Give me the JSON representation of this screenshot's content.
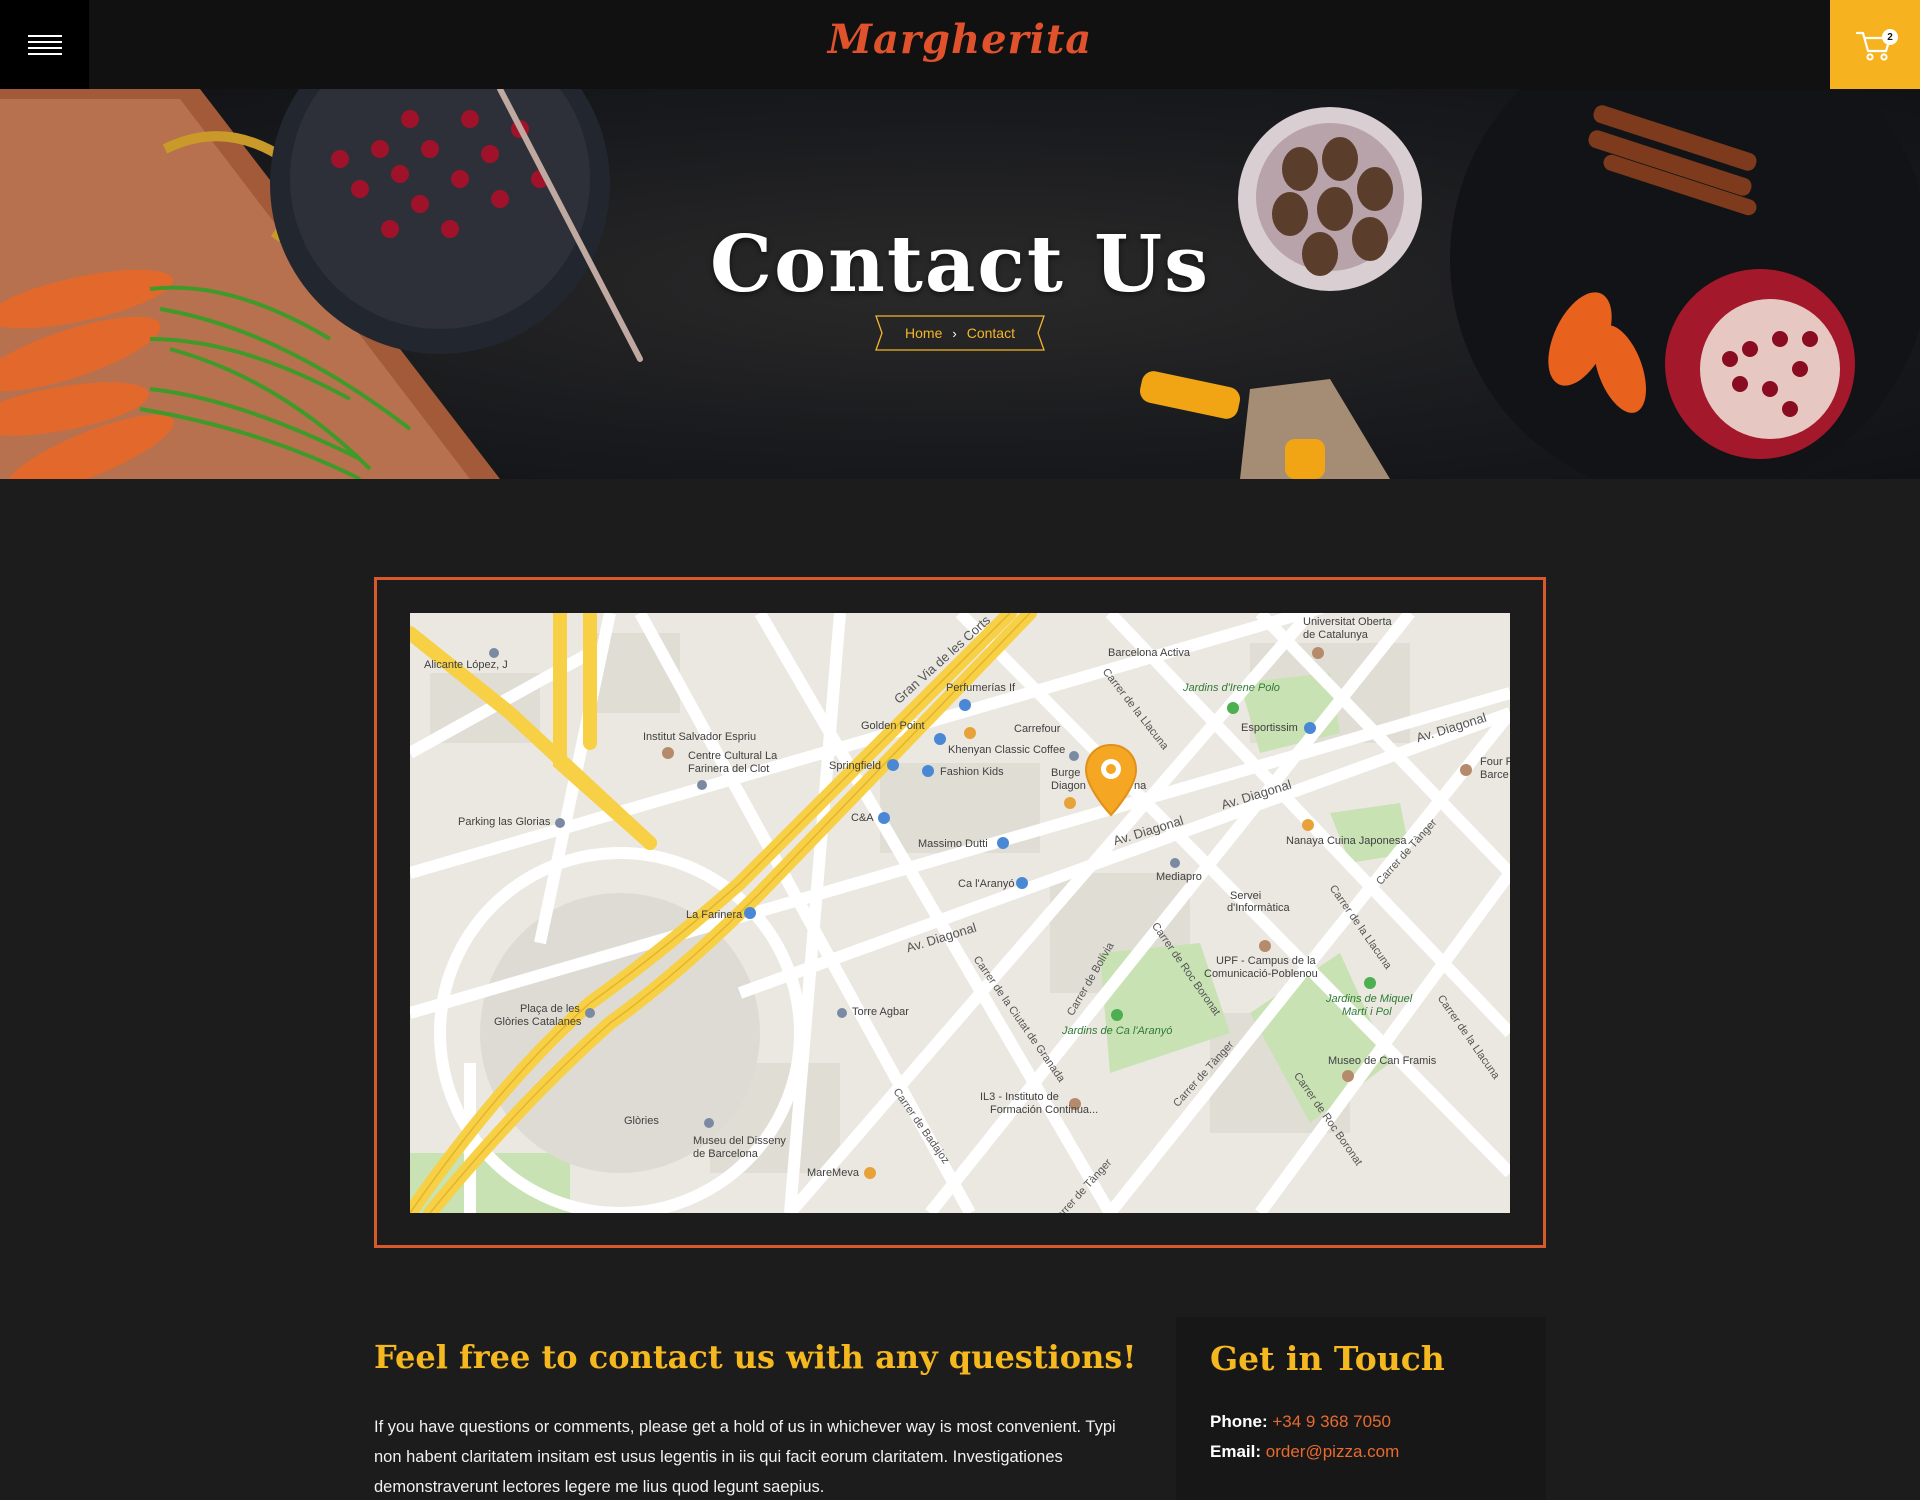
{
  "header": {
    "logo": "Margherita",
    "cart_count": "2"
  },
  "hero": {
    "title": "Contact Us",
    "breadcrumb": {
      "home": "Home",
      "current": "Contact"
    }
  },
  "map": {
    "labels": [
      "Alicante López, J",
      "Institut Salvador Espriu",
      "Centre Cultural La",
      "Farinera del Clot",
      "Parking las Glorias",
      "Plaça de les",
      "Glòries Catalanes",
      "La Farinera",
      "Glòries",
      "Museu del Disseny",
      "de Barcelona",
      "MareMeva",
      "Torre Agbar",
      "Golden Point",
      "Springfield",
      "Perfumerías If",
      "Carrefour",
      "Khenyan Classic Coffee",
      "Fashion Kids",
      "C&A",
      "Massimo Dutti",
      "Ca l'Aranyó",
      "Barcelona Activa",
      "Universitat Oberta",
      "de Catalunya",
      "Jardins d'Irene Polo",
      "Esportissim",
      "Nanaya Cuina Japonesa",
      "Mediapro",
      "Servei",
      "d'Informàtica",
      "UPF - Campus de la",
      "Comunicació-Poblenou",
      "Jardins de Miquel",
      "Martí i Pol",
      "Museo de Can Framis",
      "Jardins de Ca l'Aranyó",
      "IL3 - Instituto de",
      "Formación Continua...",
      "Four P",
      "Barce",
      "Burge",
      "Diagon",
      "na"
    ],
    "streets": [
      "Gran Via de les Corts",
      "Av. Diagonal",
      "Av. Diagonal",
      "Av. Diagonal",
      "Av. Diagonal",
      "Carrer de la Llacuna",
      "Carrer de Bolívia",
      "Carrer de Roc Boronat",
      "Carrer de la Ciutat de Granada",
      "Carrer de Badajoz",
      "Carrer de Tànger",
      "Carrer de Tànger",
      "Carrer de la Llacuna",
      "Carrer de Roc Boronat",
      "Carrer de Tànger",
      "Carrer de la Llacuna"
    ]
  },
  "contact": {
    "heading": "Feel free to contact us with any questions!",
    "text": "If you have questions or comments, please get a hold of us in whichever way is most convenient.  Typi non habent claritatem insitam est usus legentis in iis qui facit eorum claritatem. Investigationes demonstraverunt lectores legere me lius quod legunt saepius."
  },
  "touch": {
    "title": "Get in Touch",
    "phone_label": "Phone:",
    "phone": "+34 9 368 7050",
    "email_label": "Email:",
    "email": "order@pizza.com"
  },
  "colors": {
    "accent_orange": "#d65a2c",
    "accent_yellow": "#f6b81f",
    "background": "#1c1c1c"
  }
}
